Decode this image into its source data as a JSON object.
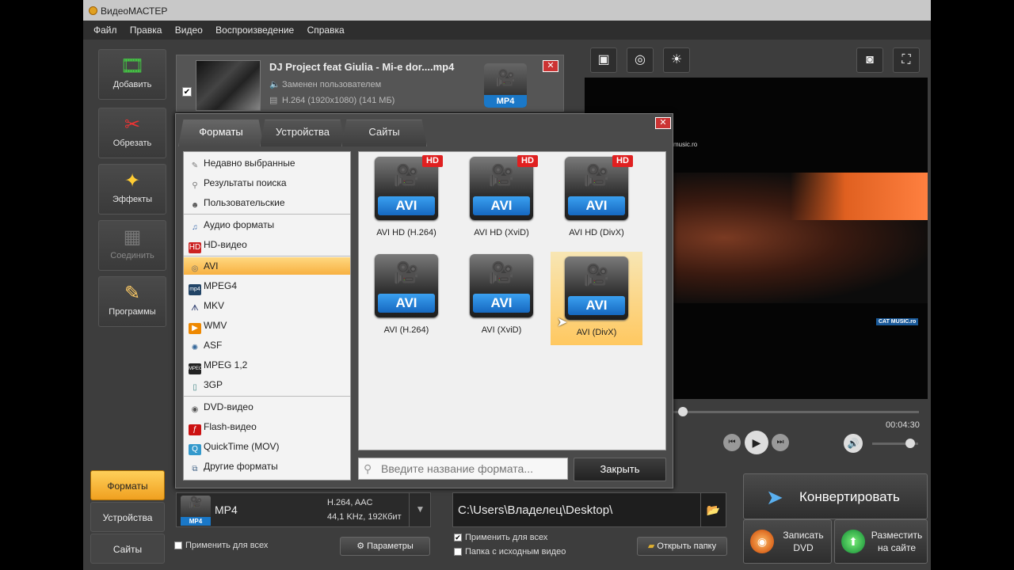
{
  "window": {
    "title": "ВидеоМАСТЕР"
  },
  "menu": [
    "Файл",
    "Правка",
    "Видео",
    "Воспроизведение",
    "Справка"
  ],
  "toolbar": [
    {
      "label": "Добавить",
      "icon": "add-film-icon",
      "enabled": true
    },
    {
      "label": "Обрезать",
      "icon": "scissors-icon",
      "enabled": true
    },
    {
      "label": "Эффекты",
      "icon": "magic-wand-icon",
      "enabled": true
    },
    {
      "label": "Соединить",
      "icon": "join-icon",
      "enabled": false
    },
    {
      "label": "Программы",
      "icon": "programs-icon",
      "enabled": true
    }
  ],
  "file": {
    "name": "DJ Project feat Giulia - Mi-e dor....mp4",
    "audio": "Заменен пользователем",
    "video": "H.264 (1920x1080) (141 МБ)",
    "format_badge": "MP4",
    "checked": true
  },
  "dialog": {
    "tabs": [
      "Форматы",
      "Устройства",
      "Сайты"
    ],
    "active_tab": "Форматы",
    "categories": [
      {
        "label": "Недавно выбранные",
        "icon": "recent-icon",
        "group": 1
      },
      {
        "label": "Результаты поиска",
        "icon": "search-results-icon",
        "group": 1
      },
      {
        "label": "Пользовательские",
        "icon": "user-icon",
        "group": 1
      },
      {
        "label": "Аудио форматы",
        "icon": "music-note-icon",
        "group": 2
      },
      {
        "label": "HD-видео",
        "icon": "hd-icon",
        "group": 2
      },
      {
        "label": "AVI",
        "icon": "avi-icon",
        "group": 3,
        "selected": true
      },
      {
        "label": "MPEG4",
        "icon": "mp4-icon",
        "group": 3
      },
      {
        "label": "MKV",
        "icon": "mkv-icon",
        "group": 3
      },
      {
        "label": "WMV",
        "icon": "wmv-icon",
        "group": 3
      },
      {
        "label": "ASF",
        "icon": "asf-icon",
        "group": 3
      },
      {
        "label": "MPEG 1,2",
        "icon": "mpeg-icon",
        "group": 3
      },
      {
        "label": "3GP",
        "icon": "phone-icon",
        "group": 3
      },
      {
        "label": "DVD-видео",
        "icon": "dvd-icon",
        "group": 4
      },
      {
        "label": "Flash-видео",
        "icon": "flash-icon",
        "group": 4
      },
      {
        "label": "QuickTime (MOV)",
        "icon": "quicktime-icon",
        "group": 4
      },
      {
        "label": "Другие форматы",
        "icon": "other-formats-icon",
        "group": 4
      }
    ],
    "formats": [
      {
        "badge": "AVI",
        "hd": "HD",
        "caption": "AVI HD (H.264)"
      },
      {
        "badge": "AVI",
        "hd": "HD",
        "caption": "AVI HD (XviD)"
      },
      {
        "badge": "AVI",
        "hd": "HD",
        "caption": "AVI HD (DivX)"
      },
      {
        "badge": "AVI",
        "hd": "",
        "caption": "AVI (H.264)"
      },
      {
        "badge": "AVI",
        "hd": "",
        "caption": "AVI (XviD)"
      },
      {
        "badge": "AVI",
        "hd": "",
        "caption": "AVI (DivX)",
        "selected": true
      }
    ],
    "search_placeholder": "Введите название формата...",
    "close_label": "Закрыть"
  },
  "preview": {
    "time": "00:04:30",
    "watermark_top": "music.ro",
    "watermark_bottom": "CAT MUSIC.ro",
    "seek_fraction": 0.02,
    "volume_fraction": 0.85
  },
  "left_tabs": {
    "formats": "Форматы",
    "devices": "Устройства",
    "sites": "Сайты",
    "active": "Форматы"
  },
  "output_format": {
    "badge": "MP4",
    "name": "MP4",
    "codec": "H.264, AAC",
    "audio": "44,1 KHz, 192Кбит"
  },
  "apply_all_left": "Применить для всех",
  "params_label": "Параметры",
  "output_path": "C:\\Users\\Владелец\\Desktop\\",
  "apply_all_right": "Применить для всех",
  "source_folder": "Папка с исходным видео",
  "open_folder": "Открыть папку",
  "convert_label": "Конвертировать",
  "burn_dvd": "Записать DVD",
  "publish": "Разместить на сайте"
}
